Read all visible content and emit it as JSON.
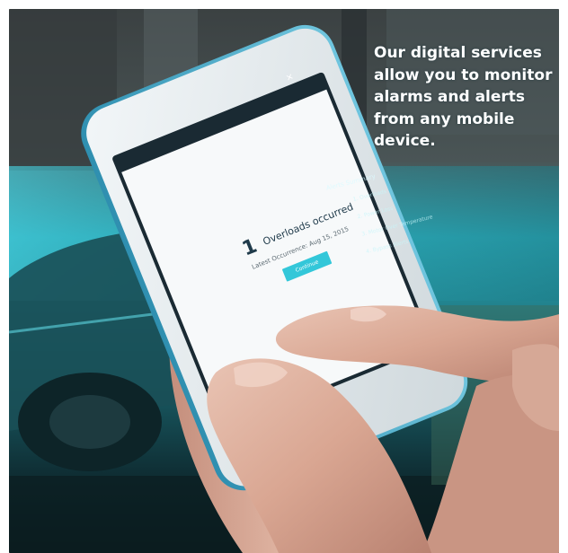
{
  "headline": "Our digital services allow you to monitor alarms and alerts from any mobile device.",
  "phone_alert": {
    "count": "1",
    "message": "Overloads occurred",
    "subtext": "Latest Occurrence: Aug 15, 2015",
    "button_label": "Continue",
    "close_symbol": "×",
    "icon": "warning-triangle-icon"
  },
  "hologram": {
    "title": "Alerts Summary",
    "items": [
      "1. Overloads",
      "2. Power Loss",
      "3. Motor Over Temperature",
      "4. Bypass Alerts"
    ]
  },
  "colors": {
    "alert_red": "#e8414f",
    "button_cyan": "#33c7d9",
    "background_teal": "#1c5e68",
    "text_white": "#ffffff"
  }
}
